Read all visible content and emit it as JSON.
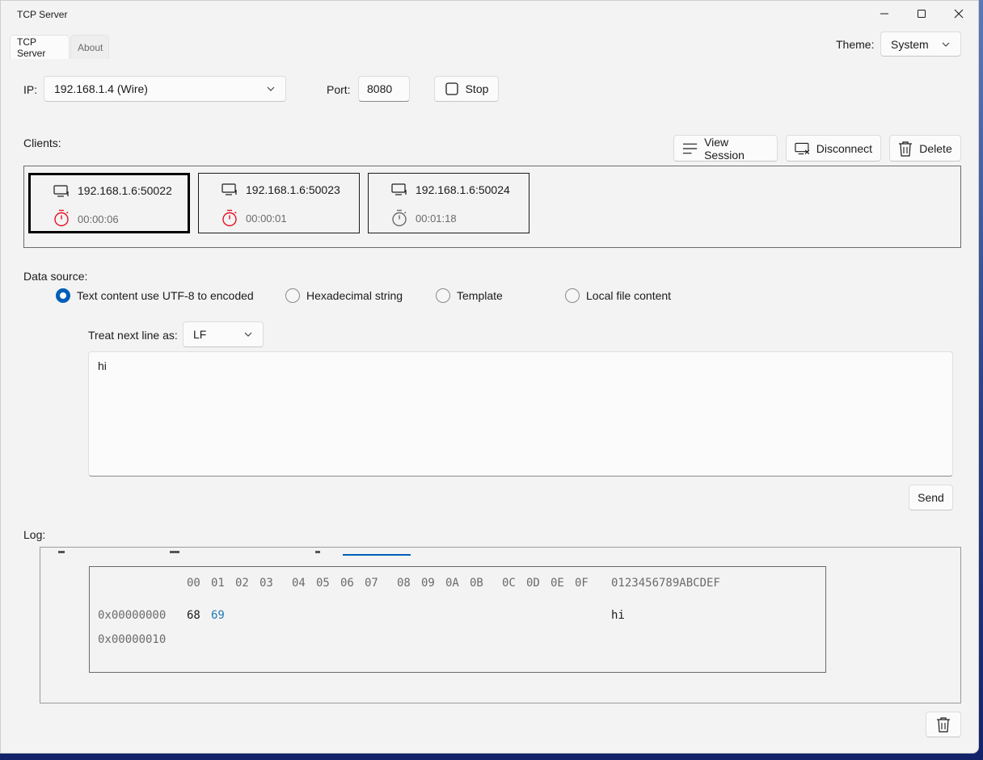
{
  "window": {
    "title": "TCP Server"
  },
  "tabs": [
    {
      "label": "TCP Server",
      "active": true
    },
    {
      "label": "About",
      "active": false
    }
  ],
  "theme": {
    "label": "Theme:",
    "value": "System"
  },
  "connection": {
    "ip_label": "IP:",
    "ip_value": "192.168.1.4 (Wire)",
    "port_label": "Port:",
    "port_value": "8080",
    "stop_label": "Stop"
  },
  "clients": {
    "label": "Clients:",
    "view_session_label": "View Session",
    "disconnect_label": "Disconnect",
    "delete_label": "Delete",
    "items": [
      {
        "address": "192.168.1.6:50022",
        "elapsed": "00:00:06",
        "active": true
      },
      {
        "address": "192.168.1.6:50023",
        "elapsed": "00:00:01",
        "active": true
      },
      {
        "address": "192.168.1.6:50024",
        "elapsed": "00:01:18",
        "active": false
      }
    ]
  },
  "data_source": {
    "label": "Data source:",
    "options": [
      {
        "label": "Text content use UTF-8 to encoded",
        "selected": true
      },
      {
        "label": "Hexadecimal string",
        "selected": false
      },
      {
        "label": "Template",
        "selected": false
      },
      {
        "label": "Local file content",
        "selected": false
      }
    ],
    "newline_label": "Treat next line as:",
    "newline_value": "LF",
    "content": "hi",
    "send_label": "Send"
  },
  "log": {
    "label": "Log:",
    "hex_header_columns": [
      "00",
      "01",
      "02",
      "03",
      "04",
      "05",
      "06",
      "07",
      "08",
      "09",
      "0A",
      "0B",
      "0C",
      "0D",
      "0E",
      "0F"
    ],
    "hex_header_ascii": "0123456789ABCDEF",
    "rows": [
      {
        "offset": "0x00000000",
        "bytes": [
          "68",
          "69"
        ],
        "ascii": "hi"
      },
      {
        "offset": "0x00000010",
        "bytes": [],
        "ascii": ""
      }
    ]
  },
  "colors": {
    "accent": "#005fb8",
    "timer_active": "#e81123",
    "hex_highlight": "#1f7ab8"
  }
}
